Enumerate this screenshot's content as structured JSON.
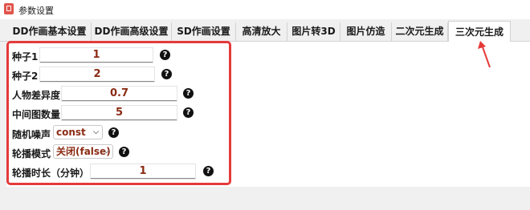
{
  "window": {
    "title": "参数设置",
    "icon": "app-icon"
  },
  "tabs": [
    {
      "label": "DD作画基本设置",
      "active": false
    },
    {
      "label": "DD作画高级设置",
      "active": false
    },
    {
      "label": "SD作画设置",
      "active": false
    },
    {
      "label": "高清放大",
      "active": false
    },
    {
      "label": "图片转3D",
      "active": false
    },
    {
      "label": "图片仿造",
      "active": false
    },
    {
      "label": "二次元生成",
      "active": false
    },
    {
      "label": "三次元生成",
      "active": true
    }
  ],
  "form": {
    "seed1": {
      "label": "种子1",
      "value": "1"
    },
    "seed2": {
      "label": "种子2",
      "value": "2"
    },
    "character_diff": {
      "label": "人物差异度",
      "value": "0.7"
    },
    "intermediate_count": {
      "label": "中间图数量",
      "value": "5"
    },
    "random_noise": {
      "label": "随机噪声",
      "selected": "const"
    },
    "carousel_mode": {
      "label": "轮播模式",
      "selected": "关闭(false)"
    },
    "carousel_duration": {
      "label": "轮播时长（分钟）",
      "value": "1"
    }
  },
  "help_glyph": "?",
  "dropdown_glyph": "⌵",
  "colors": {
    "highlight": "#e43a3a",
    "value_text": "#8b2b14",
    "arrow": "#e43a3a"
  }
}
